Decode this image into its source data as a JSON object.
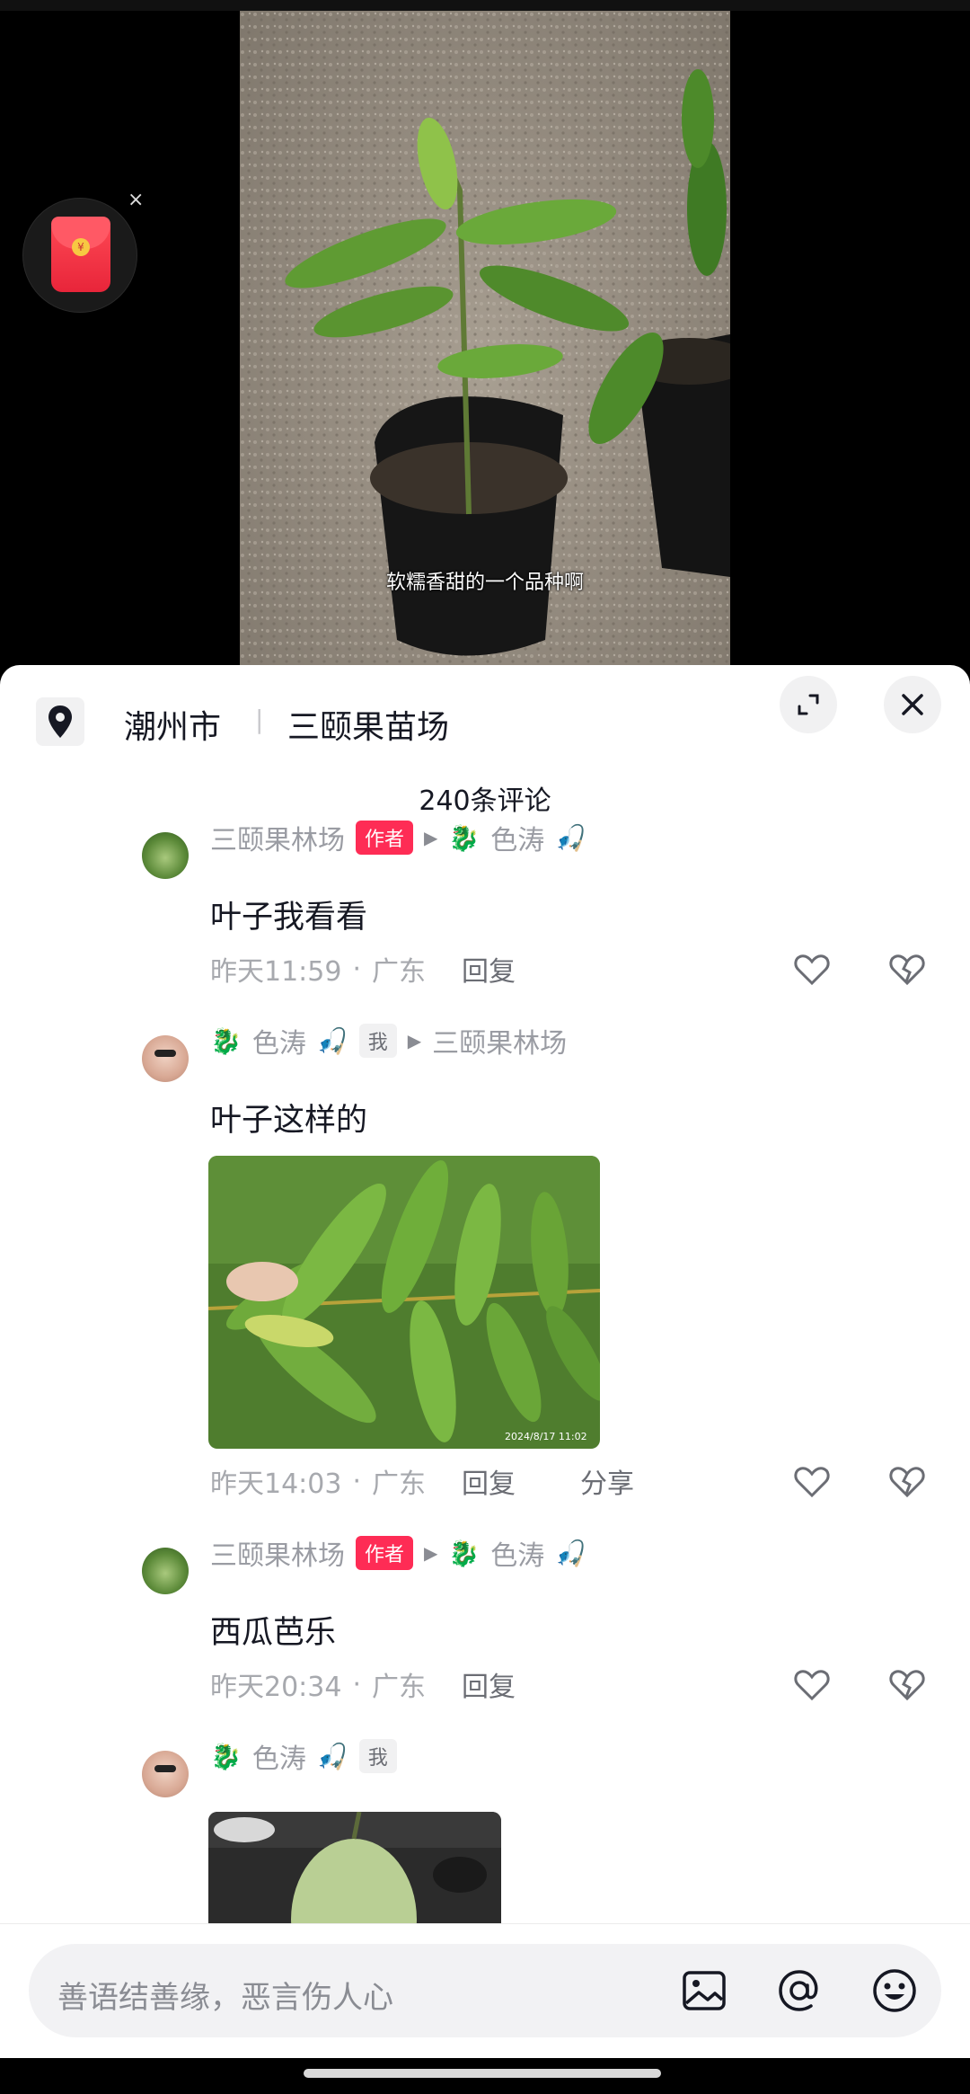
{
  "video": {
    "caption": "软糯香甜的一个品种啊"
  },
  "red_packet": {
    "close_glyph": "×",
    "coin_glyph": "¥"
  },
  "location": {
    "city": "潮州市",
    "separator": "|",
    "place": "三颐果苗场"
  },
  "comment_count": "240条评论",
  "comments": [
    {
      "user": "三颐果林场",
      "tag": "作者",
      "reply_to": "色涛",
      "text": "叶子我看看",
      "time": "昨天11:59",
      "dot": "·",
      "region": "广东",
      "reply": "回复"
    },
    {
      "user": "色涛",
      "tag": "我",
      "reply_to": "三颐果林场",
      "text": "叶子这样的",
      "image_stamp": "2024/8/17 11:02",
      "time": "昨天14:03",
      "dot": "·",
      "region": "广东",
      "reply": "回复",
      "share": "分享"
    },
    {
      "user": "三颐果林场",
      "tag": "作者",
      "reply_to": "色涛",
      "text": "西瓜芭乐",
      "time": "昨天20:34",
      "dot": "·",
      "region": "广东",
      "reply": "回复"
    },
    {
      "user": "色涛",
      "tag": "我"
    }
  ],
  "input": {
    "placeholder": "善语结善缘，恶言伤人心"
  },
  "icons": {
    "location": "location-pin-icon",
    "expand": "expand-icon",
    "close": "close-icon",
    "like": "heart-icon",
    "dislike": "broken-heart-icon",
    "image": "image-icon",
    "mention": "at-icon",
    "emoji": "emoji-icon"
  },
  "colors": {
    "author_tag": "#fe2c55",
    "muted_text": "#a7a9ae",
    "primary_text": "#161823"
  }
}
